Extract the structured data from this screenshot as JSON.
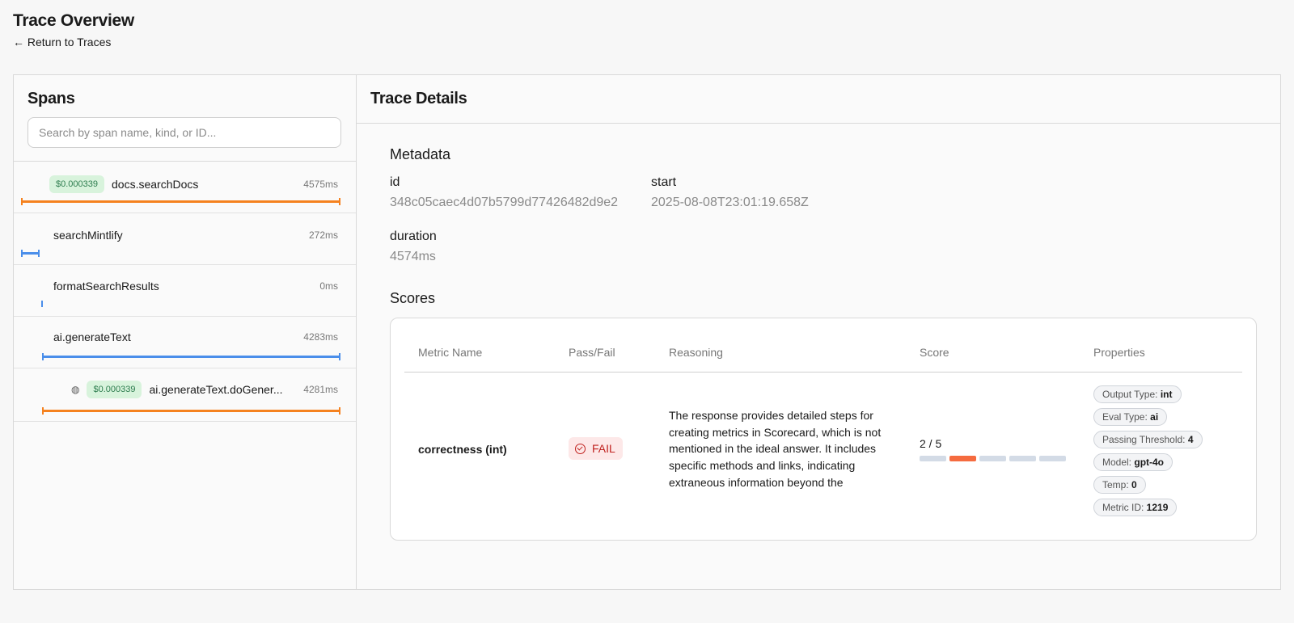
{
  "page": {
    "title": "Trace Overview",
    "back_label": "← Return to Traces"
  },
  "spans": {
    "title": "Spans",
    "search_placeholder": "Search by span name, kind, or ID...",
    "items": [
      {
        "name": "docs.searchDocs",
        "duration": "4575ms",
        "cost": "$0.000339",
        "bar_color": "#f5821f"
      },
      {
        "name": "searchMintlify",
        "duration": "272ms",
        "cost": "",
        "bar_color": "#4a8eea"
      },
      {
        "name": "formatSearchResults",
        "duration": "0ms",
        "cost": "",
        "bar_color": "#4a8eea"
      },
      {
        "name": "ai.generateText",
        "duration": "4283ms",
        "cost": "",
        "bar_color": "#4a8eea"
      },
      {
        "name": "ai.generateText.doGener...",
        "duration": "4281ms",
        "cost": "$0.000339",
        "icon": "globe-icon",
        "bar_color": "#f5821f"
      }
    ]
  },
  "details": {
    "title": "Trace Details",
    "metadata": {
      "title": "Metadata",
      "id_label": "id",
      "id_value": "348c05caec4d07b5799d77426482d9e2",
      "start_label": "start",
      "start_value": "2025-08-08T23:01:19.658Z",
      "duration_label": "duration",
      "duration_value": "4574ms"
    },
    "scores": {
      "title": "Scores",
      "headers": [
        "Metric Name",
        "Pass/Fail",
        "Reasoning",
        "Score",
        "Properties"
      ],
      "row": {
        "metric": "correctness (int)",
        "status": "FAIL",
        "status_color": "#c0221f",
        "reasoning": "The response provides detailed steps for creating metrics in Scorecard, which is not mentioned in the ideal answer. It includes specific methods and links, indicating extraneous information beyond the",
        "score_text": "2 / 5",
        "score_value": 2,
        "score_max": 5,
        "score_highlight": 2,
        "properties": [
          {
            "label": "Output Type:",
            "value": "int"
          },
          {
            "label": "Eval Type:",
            "value": "ai"
          },
          {
            "label": "Passing Threshold:",
            "value": "4"
          },
          {
            "label": "Model:",
            "value": "gpt-4o"
          },
          {
            "label": "Temp:",
            "value": "0"
          },
          {
            "label": "Metric ID:",
            "value": "1219"
          }
        ]
      }
    }
  }
}
